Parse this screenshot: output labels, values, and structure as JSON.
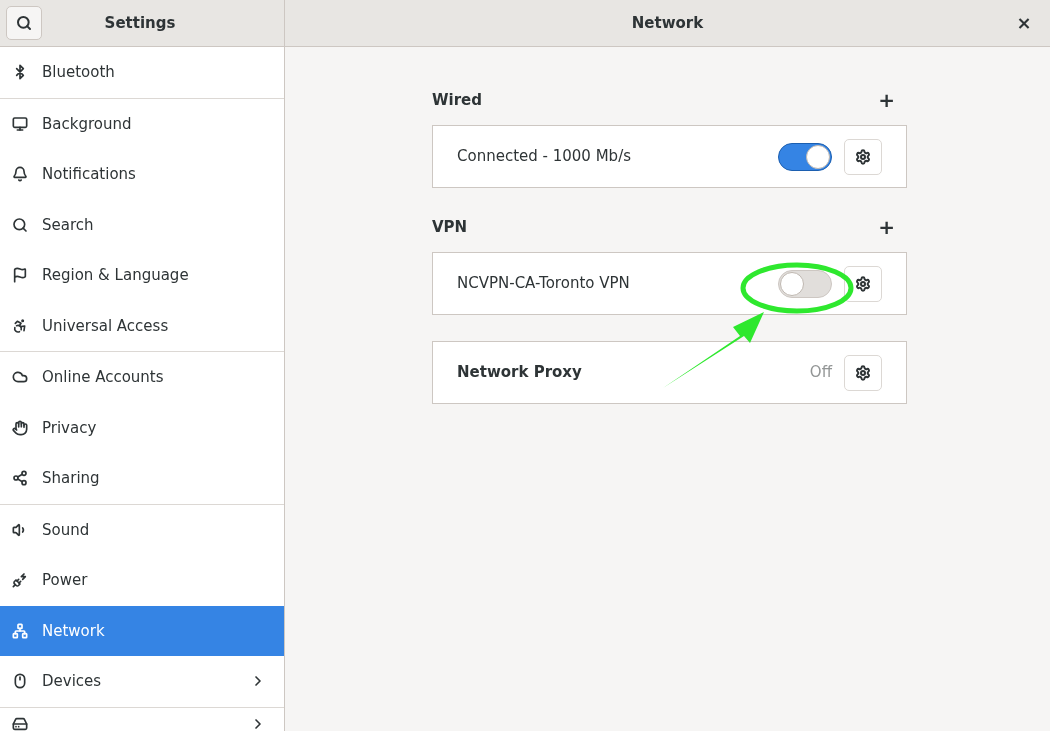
{
  "header": {
    "sidebar_title": "Settings",
    "page_title": "Network",
    "close": "×"
  },
  "sidebar": {
    "groups": [
      [
        {
          "label": "Bluetooth",
          "selected": false,
          "has_arrow": false
        }
      ],
      [
        {
          "label": "Background",
          "selected": false,
          "has_arrow": false
        },
        {
          "label": "Notifications",
          "selected": false,
          "has_arrow": false
        },
        {
          "label": "Search",
          "selected": false,
          "has_arrow": false
        },
        {
          "label": "Region & Language",
          "selected": false,
          "has_arrow": false
        },
        {
          "label": "Universal Access",
          "selected": false,
          "has_arrow": false
        }
      ],
      [
        {
          "label": "Online Accounts",
          "selected": false,
          "has_arrow": false
        },
        {
          "label": "Privacy",
          "selected": false,
          "has_arrow": false
        },
        {
          "label": "Sharing",
          "selected": false,
          "has_arrow": false
        }
      ],
      [
        {
          "label": "Sound",
          "selected": false,
          "has_arrow": false
        },
        {
          "label": "Power",
          "selected": false,
          "has_arrow": false
        },
        {
          "label": "Network",
          "selected": true,
          "has_arrow": false
        },
        {
          "label": "Devices",
          "selected": false,
          "has_arrow": true
        }
      ],
      [
        {
          "selected": false,
          "has_arrow": true
        }
      ]
    ]
  },
  "sections": [
    {
      "title": "Wired",
      "add": "+",
      "rows": [
        {
          "kind": "switch",
          "label": "Connected - 1000 Mb/s",
          "on": true
        }
      ]
    },
    {
      "title": "VPN",
      "add": "+",
      "rows": [
        {
          "kind": "switch",
          "label": "NCVPN-CA-Toronto VPN",
          "on": false
        }
      ]
    },
    {
      "rows": [
        {
          "kind": "status",
          "label": "Network Proxy",
          "status": "Off"
        }
      ]
    }
  ]
}
